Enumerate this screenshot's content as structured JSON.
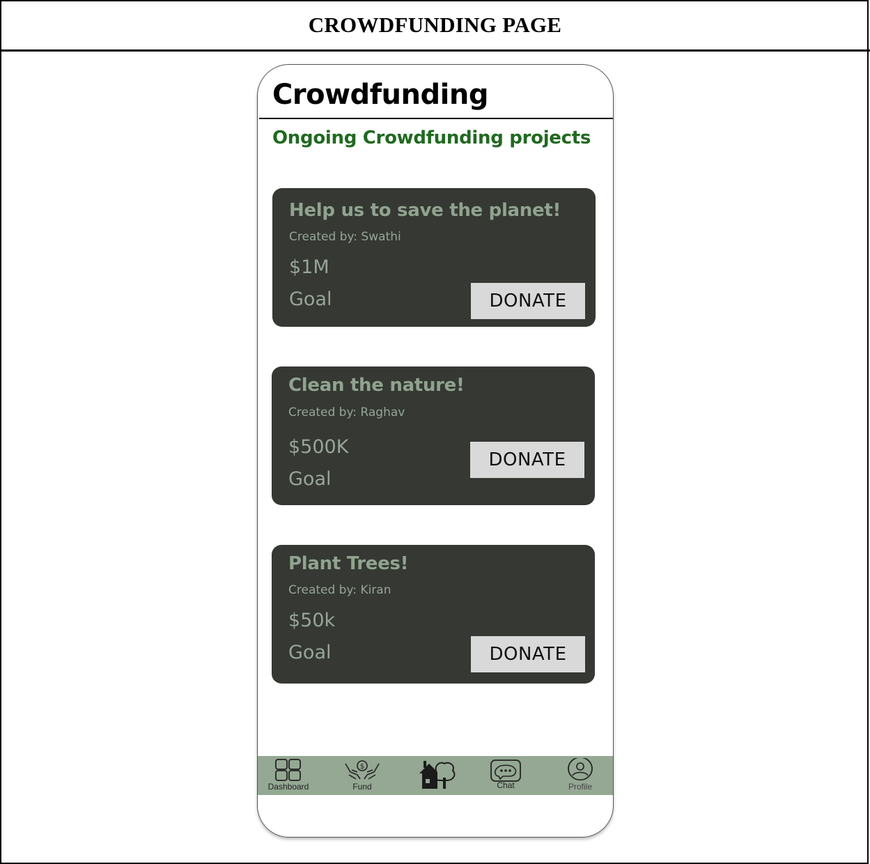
{
  "page": {
    "heading": "CROWDFUNDING PAGE"
  },
  "app": {
    "title": "Crowdfunding",
    "section_title": "Ongoing Crowdfunding projects",
    "accent_color": "#1f6a1f",
    "card_color": "#353833",
    "nav_color": "#94a893"
  },
  "projects": [
    {
      "title": "Help us to save the planet!",
      "creator": "Created by: Swathi",
      "amount": "$1M",
      "goal_label": "Goal",
      "button": "DONATE"
    },
    {
      "title": "Clean the nature!",
      "creator": "Created by: Raghav",
      "amount": "$500K",
      "goal_label": "Goal",
      "button": "DONATE"
    },
    {
      "title": "Plant Trees!",
      "creator": "Created by: Kiran",
      "amount": "$50k",
      "goal_label": "Goal",
      "button": "DONATE"
    }
  ],
  "nav": [
    {
      "label": "Dashboard",
      "icon": "dashboard-grid-icon"
    },
    {
      "label": "Fund",
      "icon": "hands-money-icon"
    },
    {
      "label": "",
      "icon": "house-tree-icon"
    },
    {
      "label": "Chat",
      "icon": "chat-bubble-icon"
    },
    {
      "label": "Profile",
      "icon": "profile-icon"
    }
  ]
}
